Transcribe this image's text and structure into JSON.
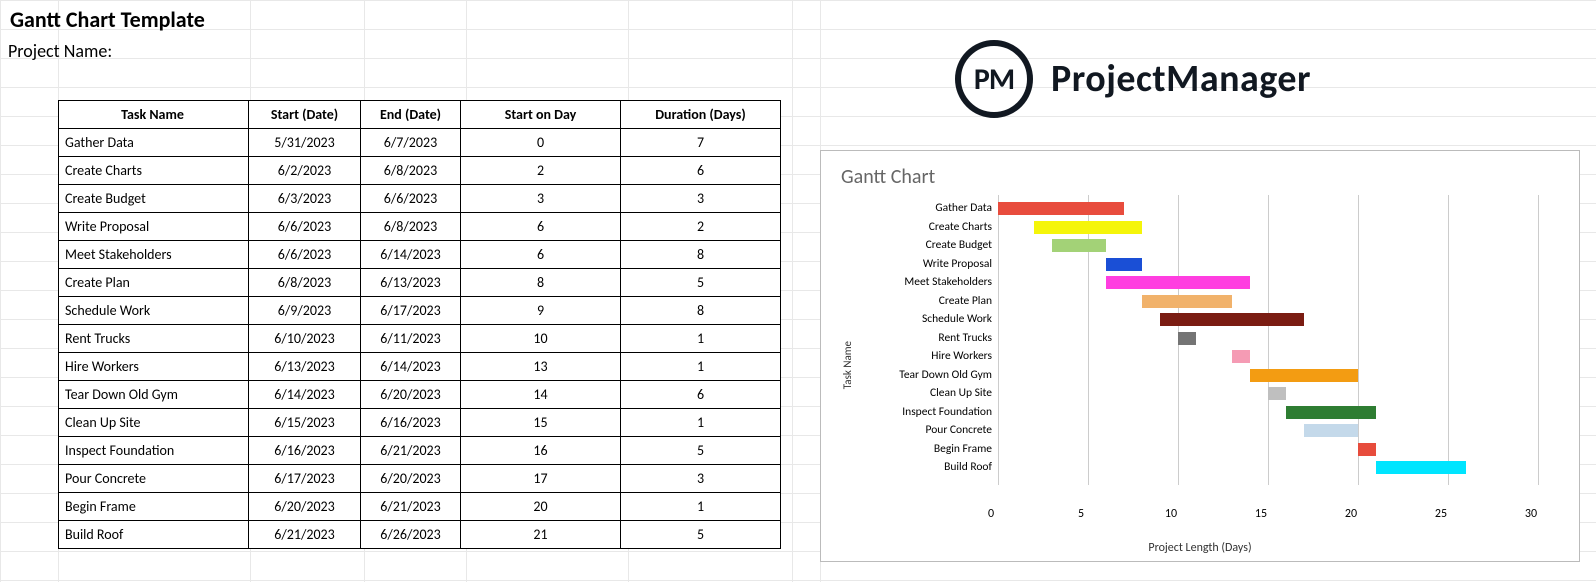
{
  "header": {
    "title": "Gantt Chart Template",
    "subtitle": "Project Name:"
  },
  "logo": {
    "icon_text": "PM",
    "brand_text": "ProjectManager"
  },
  "table": {
    "columns": [
      "Task Name",
      "Start (Date)",
      "End (Date)",
      "Start on Day",
      "Duration (Days)"
    ],
    "rows": [
      {
        "task": "Gather Data",
        "start": "5/31/2023",
        "end": "6/7/2023",
        "start_on_day": 0,
        "duration": 7
      },
      {
        "task": "Create Charts",
        "start": "6/2/2023",
        "end": "6/8/2023",
        "start_on_day": 2,
        "duration": 6
      },
      {
        "task": "Create Budget",
        "start": "6/3/2023",
        "end": "6/6/2023",
        "start_on_day": 3,
        "duration": 3
      },
      {
        "task": "Write Proposal",
        "start": "6/6/2023",
        "end": "6/8/2023",
        "start_on_day": 6,
        "duration": 2
      },
      {
        "task": "Meet Stakeholders",
        "start": "6/6/2023",
        "end": "6/14/2023",
        "start_on_day": 6,
        "duration": 8
      },
      {
        "task": "Create Plan",
        "start": "6/8/2023",
        "end": "6/13/2023",
        "start_on_day": 8,
        "duration": 5
      },
      {
        "task": "Schedule Work",
        "start": "6/9/2023",
        "end": "6/17/2023",
        "start_on_day": 9,
        "duration": 8
      },
      {
        "task": "Rent Trucks",
        "start": "6/10/2023",
        "end": "6/11/2023",
        "start_on_day": 10,
        "duration": 1
      },
      {
        "task": "Hire Workers",
        "start": "6/13/2023",
        "end": "6/14/2023",
        "start_on_day": 13,
        "duration": 1
      },
      {
        "task": "Tear Down Old Gym",
        "start": "6/14/2023",
        "end": "6/20/2023",
        "start_on_day": 14,
        "duration": 6
      },
      {
        "task": "Clean Up Site",
        "start": "6/15/2023",
        "end": "6/16/2023",
        "start_on_day": 15,
        "duration": 1
      },
      {
        "task": "Inspect Foundation",
        "start": "6/16/2023",
        "end": "6/21/2023",
        "start_on_day": 16,
        "duration": 5
      },
      {
        "task": "Pour Concrete",
        "start": "6/17/2023",
        "end": "6/20/2023",
        "start_on_day": 17,
        "duration": 3
      },
      {
        "task": "Begin Frame",
        "start": "6/20/2023",
        "end": "6/21/2023",
        "start_on_day": 20,
        "duration": 1
      },
      {
        "task": "Build Roof",
        "start": "6/21/2023",
        "end": "6/26/2023",
        "start_on_day": 21,
        "duration": 5
      }
    ]
  },
  "chart_data": {
    "type": "bar",
    "orientation": "horizontal",
    "title": "Gantt Chart",
    "xlabel": "Project Length (Days)",
    "ylabel": "Task Name",
    "xlim": [
      0,
      30
    ],
    "x_ticks": [
      0,
      5,
      10,
      15,
      20,
      25,
      30
    ],
    "categories": [
      "Gather Data",
      "Create Charts",
      "Create Budget",
      "Write Proposal",
      "Meet Stakeholders",
      "Create Plan",
      "Schedule Work",
      "Rent Trucks",
      "Hire Workers",
      "Tear Down Old Gym",
      "Clean Up Site",
      "Inspect Foundation",
      "Pour Concrete",
      "Begin Frame",
      "Build Roof"
    ],
    "series": [
      {
        "name": "Start on Day",
        "values": [
          0,
          2,
          3,
          6,
          6,
          8,
          9,
          10,
          13,
          14,
          15,
          16,
          17,
          20,
          21
        ]
      },
      {
        "name": "Duration (Days)",
        "values": [
          7,
          6,
          3,
          2,
          8,
          5,
          8,
          1,
          1,
          6,
          1,
          5,
          3,
          1,
          5
        ]
      }
    ],
    "bar_colors": [
      "#e84c3d",
      "#f5f50a",
      "#a3d277",
      "#1a4fd6",
      "#ff3ee0",
      "#f1b26b",
      "#7a1c12",
      "#747474",
      "#f59bb4",
      "#f39c12",
      "#bfbfbf",
      "#2e7d32",
      "#c4d9ea",
      "#e74c3c",
      "#00e5ff"
    ]
  }
}
